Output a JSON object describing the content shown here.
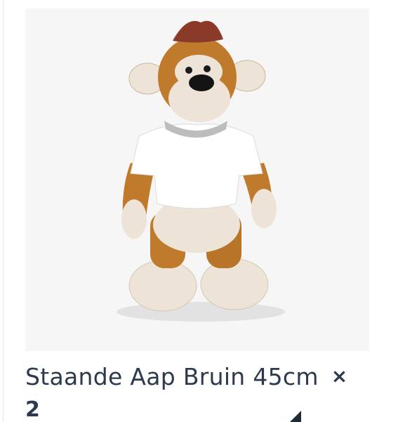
{
  "product": {
    "title": "Staande Aap Bruin 45cm",
    "remove_icon": "close-icon",
    "quantity": "2",
    "image_icon": "plush-monkey-image"
  },
  "colors": {
    "text": "#2d3a4d",
    "fur_brown": "#c07a2c",
    "fur_cream": "#ede3d6",
    "tuft": "#8b3a2a",
    "shirt": "#ffffff"
  }
}
